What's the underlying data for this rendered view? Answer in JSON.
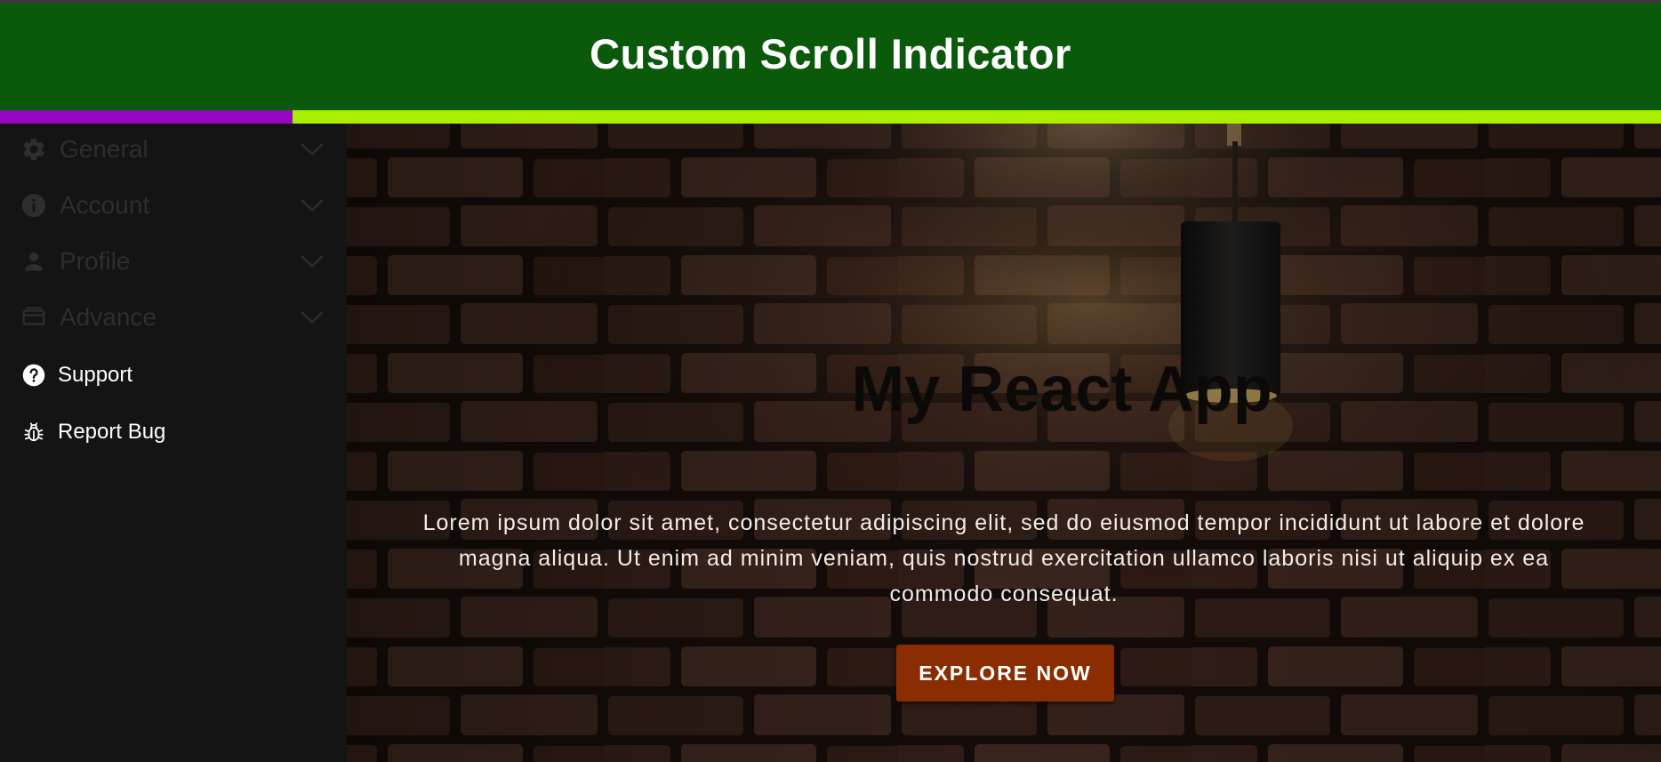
{
  "header": {
    "title": "Custom Scroll Indicator"
  },
  "scroll_indicator": {
    "progress_fraction": 0.176,
    "fill_color": "#9406c0",
    "track_color": "#aaee00"
  },
  "sidebar": {
    "items": [
      {
        "label": "General",
        "icon": "gear-icon",
        "expandable": true
      },
      {
        "label": "Account",
        "icon": "info-icon",
        "expandable": true
      },
      {
        "label": "Profile",
        "icon": "person-icon",
        "expandable": true
      },
      {
        "label": "Advance",
        "icon": "window-icon",
        "expandable": true
      },
      {
        "label": "Support",
        "icon": "help-icon",
        "expandable": false
      },
      {
        "label": "Report Bug",
        "icon": "bug-icon",
        "expandable": false
      }
    ]
  },
  "hero": {
    "title": "My React App",
    "text": "Lorem ipsum dolor sit amet, consectetur adipiscing elit, sed do eiusmod tempor incididunt ut labore et dolore magna aliqua. Ut enim ad minim veniam, quis nostrud exercitation ullamco laboris nisi ut aliquip ex ea commodo consequat.",
    "cta_label": "EXPLORE NOW"
  },
  "colors": {
    "header_bg": "#0b5a0b",
    "sidebar_bg": "#141414",
    "cta_bg": "#8b2d02"
  }
}
